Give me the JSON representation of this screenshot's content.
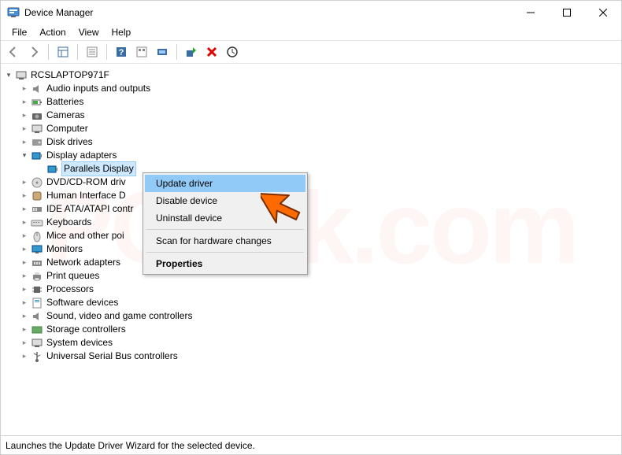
{
  "window": {
    "title": "Device Manager"
  },
  "menubar": {
    "file": "File",
    "action": "Action",
    "view": "View",
    "help": "Help"
  },
  "tree": {
    "root": "RCSLAPTOP971F",
    "items": [
      "Audio inputs and outputs",
      "Batteries",
      "Cameras",
      "Computer",
      "Disk drives",
      "Display adapters",
      "DVD/CD-ROM driv",
      "Human Interface D",
      "IDE ATA/ATAPI contr",
      "Keyboards",
      "Mice and other poi",
      "Monitors",
      "Network adapters",
      "Print queues",
      "Processors",
      "Software devices",
      "Sound, video and game controllers",
      "Storage controllers",
      "System devices",
      "Universal Serial Bus controllers"
    ],
    "display_child": "Parallels Display"
  },
  "context_menu": {
    "update": "Update driver",
    "disable": "Disable device",
    "uninstall": "Uninstall device",
    "scan": "Scan for hardware changes",
    "properties": "Properties"
  },
  "statusbar": {
    "text": "Launches the Update Driver Wizard for the selected device."
  }
}
